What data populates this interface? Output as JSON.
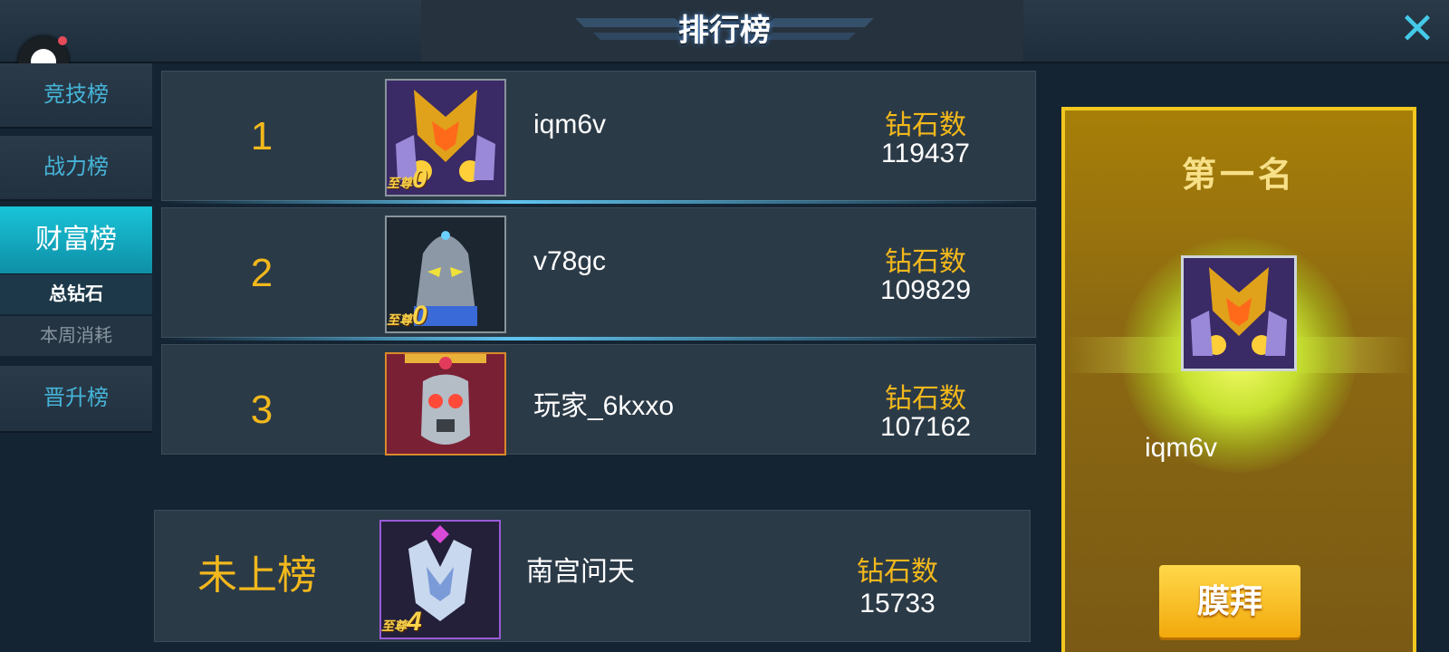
{
  "header": {
    "title": "排行榜",
    "close_icon": "close-x-icon"
  },
  "sidebar": {
    "items": [
      {
        "label": "竞技榜"
      },
      {
        "label": "战力榜"
      },
      {
        "label": "财富榜",
        "active": true,
        "subitems": [
          {
            "label": "总钻石",
            "selected": true
          },
          {
            "label": "本周消耗"
          }
        ]
      },
      {
        "label": "晋升榜"
      }
    ]
  },
  "rankings": [
    {
      "rank": "1",
      "name": "iqm6v",
      "stat_label": "钻石数",
      "stat_value": "119437",
      "badge_text": "至尊",
      "badge_level": "0"
    },
    {
      "rank": "2",
      "name": "v78gc",
      "stat_label": "钻石数",
      "stat_value": "109829",
      "badge_text": "至尊",
      "badge_level": "0"
    },
    {
      "rank": "3",
      "name": "玩家_6kxxo",
      "stat_label": "钻石数",
      "stat_value": "107162"
    }
  ],
  "self_row": {
    "rank": "未上榜",
    "name": "南宫问天",
    "stat_label": "钻石数",
    "stat_value": "15733",
    "badge_text": "至尊",
    "badge_level": "4"
  },
  "top_player": {
    "title": "第一名",
    "name": "iqm6v",
    "worship_button": "膜拜"
  },
  "colors": {
    "gold": "#f2b81c",
    "accent": "#19c4d8",
    "background": "#142433"
  }
}
